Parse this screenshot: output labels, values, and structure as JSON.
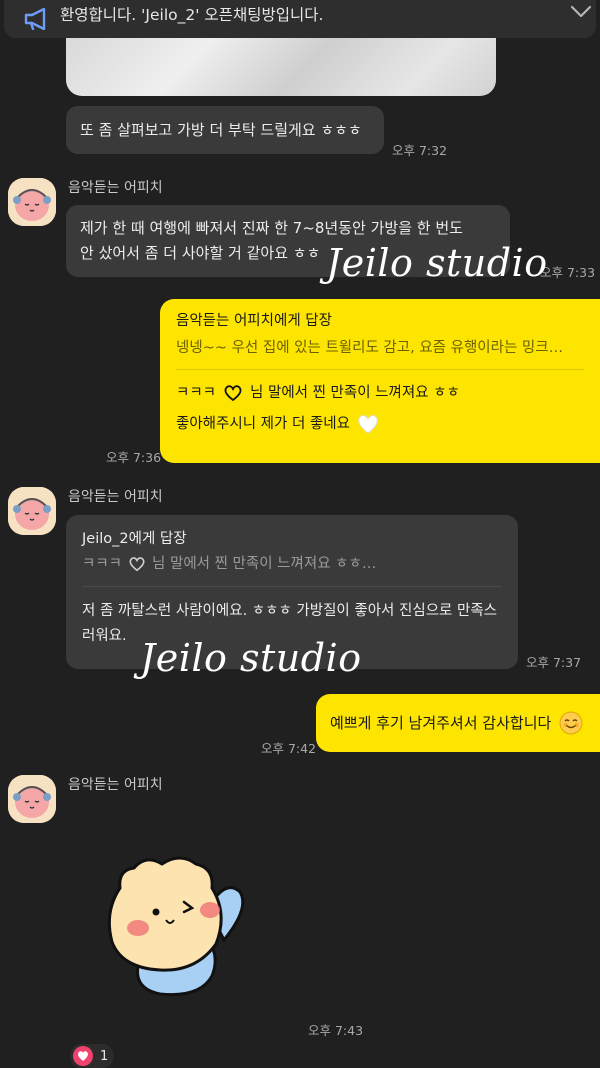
{
  "notice": {
    "text": "환영합니다. 'Jeilo_2' 오픈채팅방입니다.",
    "icon": "megaphone-icon"
  },
  "messages": {
    "m1": {
      "text": "또 좀 살펴보고 가방 더 부탁 드릴게요 ㅎㅎㅎ",
      "time": "오후 7:32"
    },
    "m2": {
      "sender": "음악듣는 어피치",
      "line1": "제가 한 때 여행에 빠져서 진짜 한 7~8년동안 가방을 한 번도",
      "line2": "안 샀어서 좀 더 사야할 거 같아요 ㅎㅎ",
      "time": "오후 7:33"
    },
    "m3": {
      "reply_to": "음악듣는 어피치에게 답장",
      "reply_snippet": "넹넹~~ 우선 집에 있는 트윌리도 감고, 요즘 유행이라는 밍크…",
      "line1_a": "ㅋㅋㅋ",
      "line1_b": "님 말에서 찐 만족이 느껴져요 ㅎㅎ",
      "line2": "좋아해주시니 제가 더 좋네요",
      "time": "오후 7:36"
    },
    "m4": {
      "sender": "음악듣는 어피치",
      "reply_to": "Jeilo_2에게 답장",
      "reply_snippet_a": "ㅋㅋㅋ",
      "reply_snippet_b": "님 말에서 찐 만족이 느껴져요 ㅎㅎ…",
      "line1": "저 좀 까탈스런 사람이에요. ㅎㅎㅎ 가방질이 좋아서 진심으로 만족스",
      "line2": "러워요.",
      "time": "오후 7:37"
    },
    "m5": {
      "text": "예쁘게 후기 남겨주셔서 감사합니다",
      "time": "오후 7:42"
    },
    "m6": {
      "sender": "음악듣는 어피치",
      "time": "오후 7:43",
      "reaction_count": "1"
    }
  },
  "watermark": "Jeilo studio",
  "colors": {
    "background": "#202020",
    "bubble_gray": "#3a3a3a",
    "bubble_yellow": "#fee500",
    "reaction_heart": "#f0426e"
  }
}
